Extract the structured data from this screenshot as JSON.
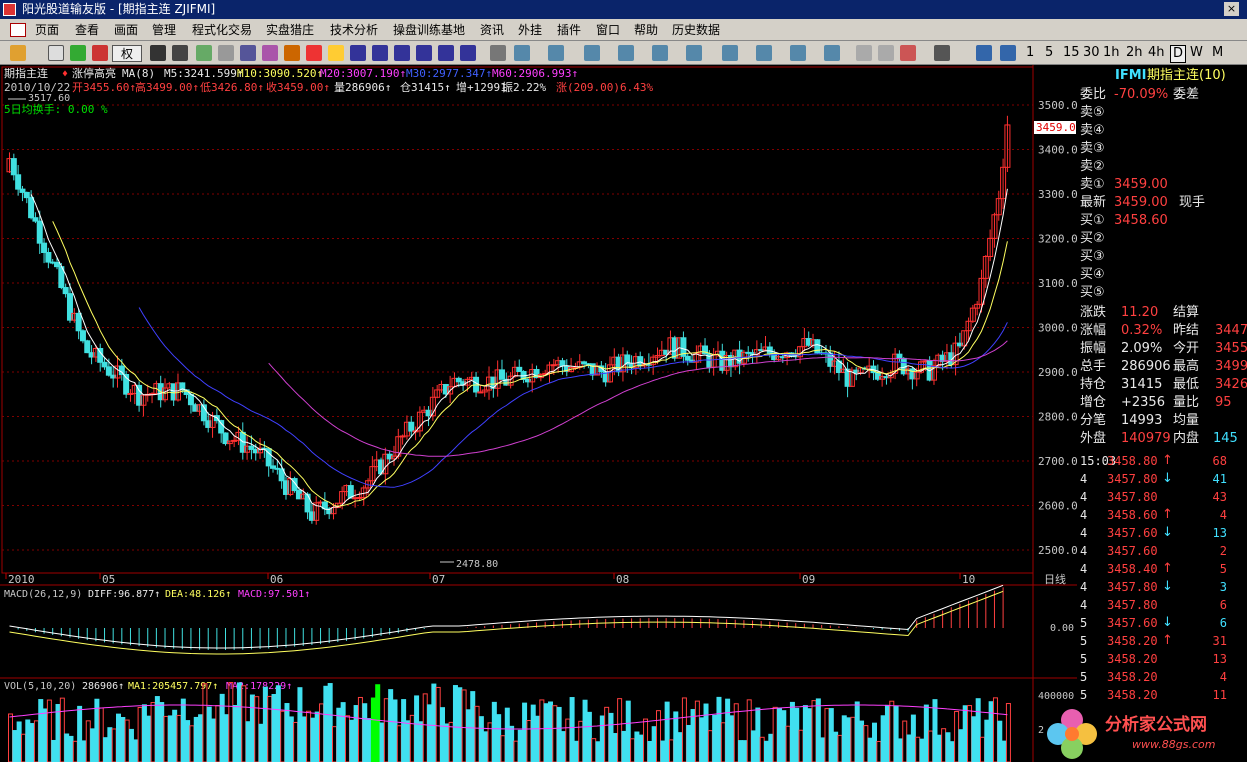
{
  "window": {
    "title": "阳光股道输友版 - [期指主连 ZJIFMI]"
  },
  "menu": [
    "页面",
    "查看",
    "画面",
    "管理",
    "程式化交易",
    "实盘猎庄",
    "技术分析",
    "操盘训练基地",
    "资讯",
    "外挂",
    "插件",
    "窗口",
    "帮助",
    "历史数据"
  ],
  "toolbar": {
    "right_label": "权",
    "periods": [
      "1",
      "5",
      "15",
      "30",
      "1h",
      "2h",
      "4h",
      "D",
      "W",
      "M"
    ],
    "active_period": "D"
  },
  "main_panel": {
    "header1": "期指主连",
    "indicator": "涨停高亮",
    "ma_label": "MA(8)",
    "ma5": "M5:3241.599↑",
    "ma10": "M10:3090.520↑",
    "ma20": "M20:3007.190↑",
    "ma30": "M30:2977.347↑",
    "ma60": "M60:2906.993↑",
    "date": "2010/10/22",
    "open": "开3455.60↑",
    "high": "高3499.00↑",
    "low": "低3426.80↑",
    "close": "收3459.00↑",
    "volume": "量286906↑",
    "oi": "仓31415↑",
    "inc": "增+12991",
    "amp": "振2.22%",
    "chg": "涨(209.00)6.43%",
    "max_label": "3517.60",
    "turnover": "5日均换手: 0.00 %",
    "min_label": "2478.80",
    "price_tag": "3459.0",
    "price_ticks": [
      "3500.0",
      "3400.0",
      "3300.0",
      "3200.0",
      "3100.0",
      "3000.0",
      "2900.0",
      "2800.0",
      "2700.0",
      "2600.0",
      "2500.0"
    ],
    "date_ticks": [
      "2010",
      "05",
      "06",
      "07",
      "08",
      "09",
      "10"
    ],
    "axis_unit": "日线"
  },
  "macd_panel": {
    "label": "MACD(26,12,9)",
    "diff": "DIFF:96.877↑",
    "dea": "DEA:48.126↑",
    "macd": "MACD:97.501↑",
    "tick": "0.00"
  },
  "vol_panel": {
    "label": "VOL(5,10,20)",
    "vol": "286906↑",
    "ma1": "MA1:205457.797↑",
    "ma2": "MA2:178229↑",
    "tick_top": "400000",
    "tick_mid": "2"
  },
  "quote": {
    "code": "IFMI",
    "name": "期指主连(10)",
    "weibi_label": "委比",
    "weibi": "-70.09%",
    "weicha_label": "委差",
    "sells": [
      [
        "卖⑤",
        ""
      ],
      [
        "卖④",
        ""
      ],
      [
        "卖③",
        ""
      ],
      [
        "卖②",
        ""
      ],
      [
        "卖①",
        "3459.00"
      ]
    ],
    "last_label": "最新",
    "last": "3459.00",
    "xianshou_label": "现手",
    "buys": [
      [
        "买①",
        "3458.60"
      ],
      [
        "买②",
        ""
      ],
      [
        "买③",
        ""
      ],
      [
        "买④",
        ""
      ],
      [
        "买⑤",
        ""
      ]
    ],
    "stats": [
      [
        "涨跌",
        "11.20",
        "结算",
        ""
      ],
      [
        "涨幅",
        "0.32%",
        "昨结",
        "3447"
      ],
      [
        "振幅",
        "2.09%",
        "今开",
        "3455"
      ],
      [
        "总手",
        "286906",
        "最高",
        "3499"
      ],
      [
        "持仓",
        "31415",
        "最低",
        "3426"
      ],
      [
        "增仓",
        "+2356",
        "量比",
        "95"
      ],
      [
        "分笔",
        "14993",
        "均量",
        ""
      ]
    ],
    "waipan_label": "外盘",
    "waipan": "140979",
    "neipan_label": "内盘",
    "neipan": "145",
    "ticks": [
      [
        "15:03",
        "3458.80",
        "↑",
        "68"
      ],
      [
        "4",
        "3457.80",
        "↓",
        "41"
      ],
      [
        "4",
        "3457.80",
        "",
        "43"
      ],
      [
        "4",
        "3458.60",
        "↑",
        "4"
      ],
      [
        "4",
        "3457.60",
        "↓",
        "13"
      ],
      [
        "4",
        "3457.60",
        "",
        "2"
      ],
      [
        "4",
        "3458.40",
        "↑",
        "5"
      ],
      [
        "4",
        "3457.80",
        "↓",
        "3"
      ],
      [
        "4",
        "3457.80",
        "",
        "6"
      ],
      [
        "5",
        "3457.60",
        "↓",
        "6"
      ],
      [
        "5",
        "3458.20",
        "↑",
        "31"
      ],
      [
        "5",
        "3458.20",
        "",
        "13"
      ],
      [
        "5",
        "3458.20",
        "",
        "4"
      ],
      [
        "5",
        "3458.20",
        "",
        "11"
      ]
    ]
  },
  "watermark": {
    "text": "分析家公式网",
    "url": "www.88gs.com"
  }
}
